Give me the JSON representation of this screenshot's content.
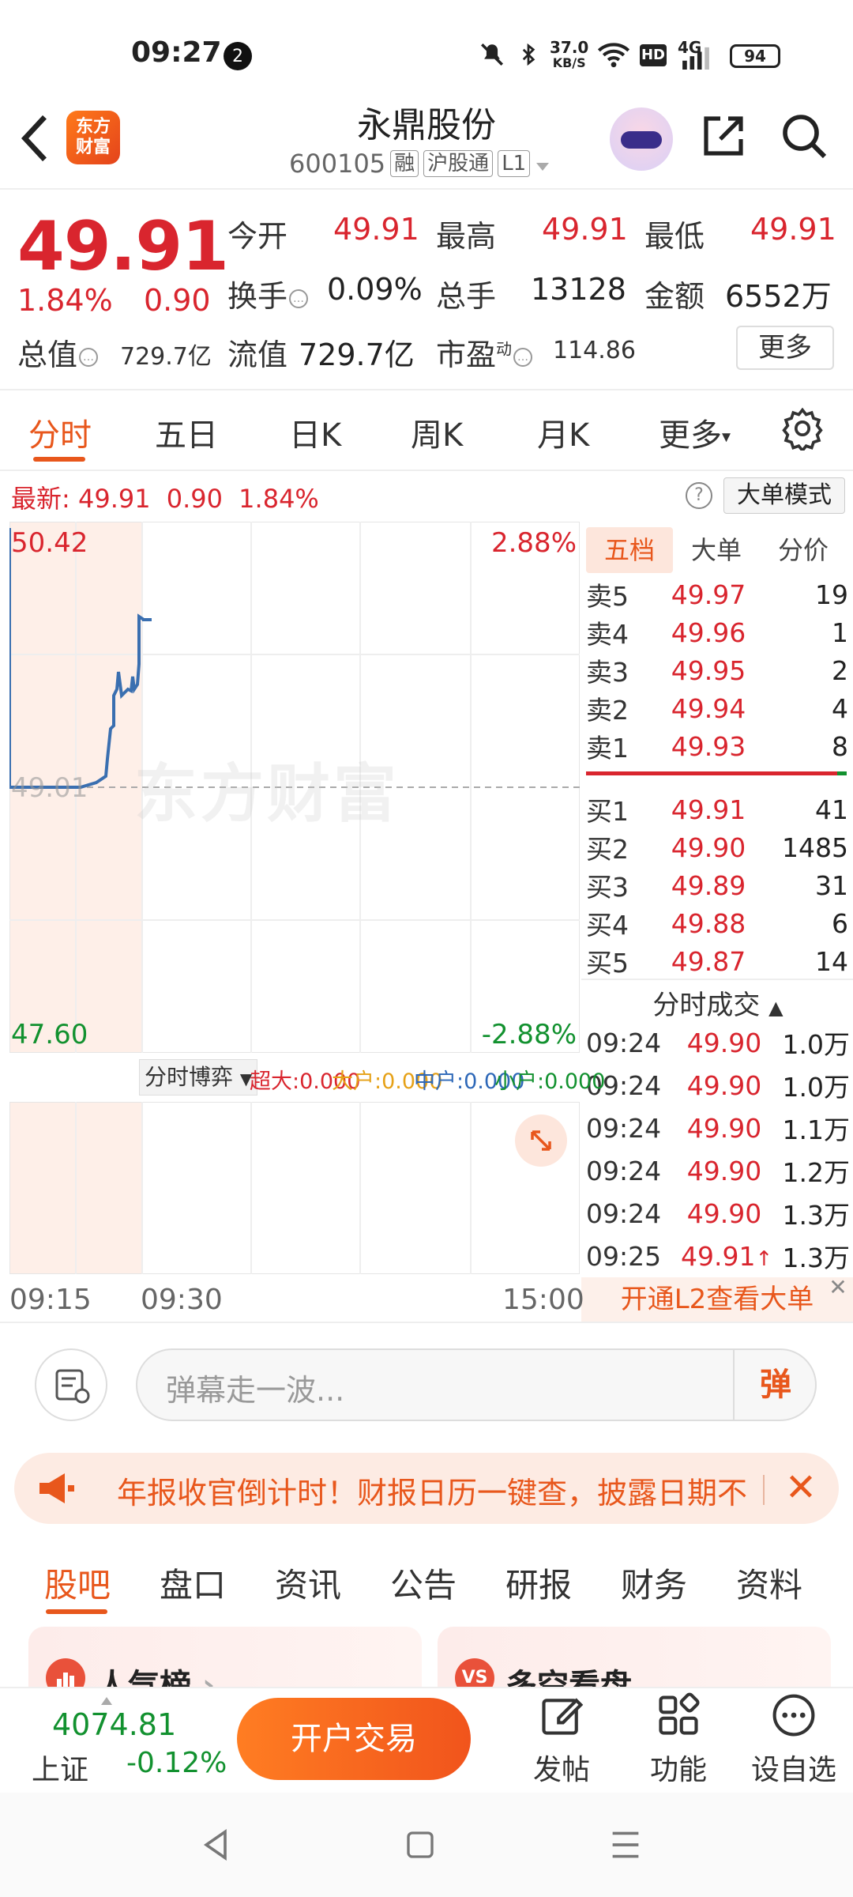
{
  "status_bar": {
    "time": "09:27",
    "notification_count": "2",
    "net_speed_value": "37.0",
    "net_speed_unit": "KB/S",
    "hd": "HD",
    "network": "4G",
    "battery": "94"
  },
  "header": {
    "logo_line1": "东方",
    "logo_line2": "财富",
    "stock_name": "永鼎股份",
    "stock_code": "600105",
    "tags": [
      "融",
      "沪股通",
      "L1"
    ]
  },
  "quote": {
    "price": "49.91",
    "change_pct": "1.84%",
    "change_abs": "0.90",
    "open_label": "今开",
    "open": "49.91",
    "high_label": "最高",
    "high": "49.91",
    "low_label": "最低",
    "low": "49.91",
    "turnover_label": "换手",
    "turnover": "0.09%",
    "volume_label": "总手",
    "volume": "13128",
    "amount_label": "金额",
    "amount": "6552万",
    "mktcap_label": "总值",
    "mktcap": "729.7亿",
    "float_label": "流值",
    "float_cap": "729.7亿",
    "pe_label": "市盈",
    "pe_sup": "动",
    "pe": "114.86",
    "more": "更多"
  },
  "chart_tabs": [
    "分时",
    "五日",
    "日K",
    "周K",
    "月K",
    "更多"
  ],
  "latest": {
    "label": "最新:",
    "price": "49.91",
    "change": "0.90",
    "pct": "1.84%",
    "mode_button": "大单模式"
  },
  "chart": {
    "upper_price": "50.42",
    "upper_pct": "2.88%",
    "base_price": "49.01",
    "lower_price": "47.60",
    "lower_pct": "-2.88%",
    "watermark": "东方财富",
    "time_start": "09:15",
    "time_open": "09:30",
    "time_end": "15:00",
    "accent_color": "#3a6fb0"
  },
  "sub_chart": {
    "dropdown": "分时博弈",
    "flows": [
      {
        "label": "超大:0.000",
        "color": "#d9252e"
      },
      {
        "label": "大户:0.000",
        "color": "#e6a117"
      },
      {
        "label": "中户:0.000",
        "color": "#2e68b8"
      },
      {
        "label": "小户:0.000",
        "color": "#12912f"
      }
    ]
  },
  "order_book": {
    "tabs": [
      "五档",
      "大单",
      "分价"
    ],
    "asks": [
      {
        "label": "卖5",
        "price": "49.97",
        "vol": "19"
      },
      {
        "label": "卖4",
        "price": "49.96",
        "vol": "1"
      },
      {
        "label": "卖3",
        "price": "49.95",
        "vol": "2"
      },
      {
        "label": "卖2",
        "price": "49.94",
        "vol": "4"
      },
      {
        "label": "卖1",
        "price": "49.93",
        "vol": "8"
      }
    ],
    "bids": [
      {
        "label": "买1",
        "price": "49.91",
        "vol": "41"
      },
      {
        "label": "买2",
        "price": "49.90",
        "vol": "1485"
      },
      {
        "label": "买3",
        "price": "49.89",
        "vol": "31"
      },
      {
        "label": "买4",
        "price": "49.88",
        "vol": "6"
      },
      {
        "label": "买5",
        "price": "49.87",
        "vol": "14"
      }
    ]
  },
  "trades": {
    "title": "分时成交",
    "rows": [
      {
        "time": "09:24",
        "price": "49.90",
        "vol": "1.0万"
      },
      {
        "time": "09:24",
        "price": "49.90",
        "vol": "1.0万"
      },
      {
        "time": "09:24",
        "price": "49.90",
        "vol": "1.1万"
      },
      {
        "time": "09:24",
        "price": "49.90",
        "vol": "1.2万"
      },
      {
        "time": "09:24",
        "price": "49.90",
        "vol": "1.3万"
      },
      {
        "time": "09:25",
        "price": "49.91",
        "vol": "1.3万"
      }
    ],
    "l2_banner": "开通L2查看大单"
  },
  "danmaku": {
    "placeholder": "弹幕走一波...",
    "send": "弹"
  },
  "announcement": {
    "text": "年报收官倒计时！财报日历一键查，披露日期不"
  },
  "bottom_tabs": [
    "股吧",
    "盘口",
    "资讯",
    "公告",
    "研报",
    "财务",
    "资料"
  ],
  "cards": {
    "popular": "人气榜",
    "popular_icon": "chart-icon",
    "longshort": "多空看盘",
    "longshort_icon": "VS"
  },
  "bottom_bar": {
    "index_value": "4074.81",
    "index_name": "上证",
    "index_change": "-0.12%",
    "trade_button": "开户交易",
    "post": "发帖",
    "functions": "功能",
    "watchlist": "设自选"
  }
}
